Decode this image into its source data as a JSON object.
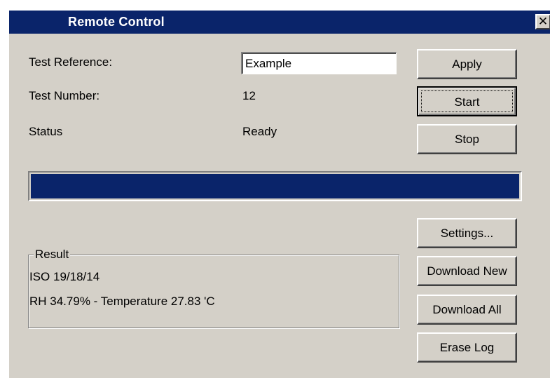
{
  "window": {
    "title": "Remote Control",
    "close_glyph": "✕"
  },
  "fields": {
    "test_reference_label": "Test Reference:",
    "test_reference_value": "Example",
    "test_number_label": "Test Number:",
    "test_number_value": "12",
    "status_label": "Status",
    "status_value": "Ready"
  },
  "buttons": {
    "apply": "Apply",
    "start": "Start",
    "stop": "Stop",
    "settings": "Settings...",
    "download_new": "Download New",
    "download_all": "Download All",
    "erase_log": "Erase Log"
  },
  "progress": {
    "fraction": 1.0,
    "color": "#0a246a"
  },
  "result": {
    "legend": "Result",
    "line1": "ISO 19/18/14",
    "line2": "RH 34.79% - Temperature 27.83 'C"
  },
  "colors": {
    "titlebar": "#0a246a",
    "face": "#d4d0c8"
  }
}
